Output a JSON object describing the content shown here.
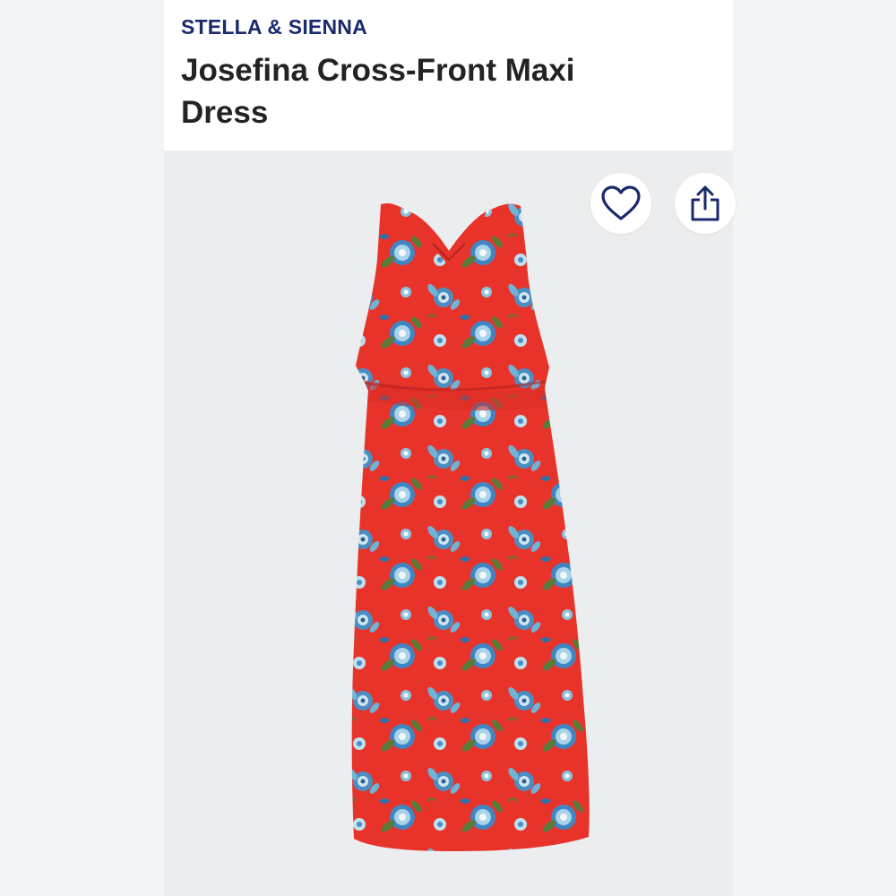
{
  "product": {
    "brand": "STELLA & SIENNA",
    "title": "Josefina Cross-Front Maxi Dress"
  },
  "actions": {
    "favorite_icon": "heart-outline-icon",
    "share_icon": "share-upload-icon"
  },
  "colors": {
    "brand_text": "#1a2a6c",
    "title_text": "#222325",
    "dress_base": "#e8332b",
    "floral_blue": "#4a8ec4",
    "floral_light": "#cfe6f0",
    "leaf_green": "#5a7a3a"
  }
}
